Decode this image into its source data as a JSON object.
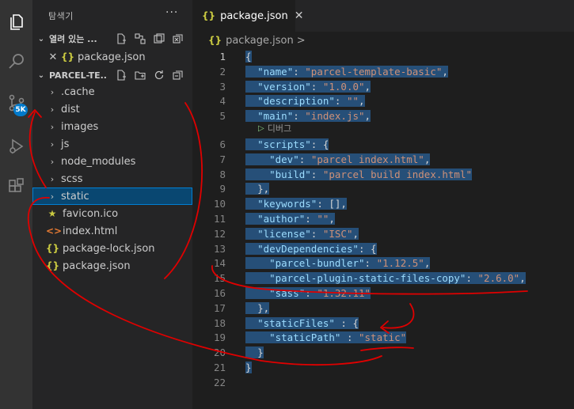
{
  "activity_bar": {
    "items": [
      {
        "icon": "files-icon"
      },
      {
        "icon": "search-icon"
      },
      {
        "icon": "source-control-icon",
        "badge": "5K"
      },
      {
        "icon": "run-debug-icon"
      },
      {
        "icon": "extensions-icon"
      }
    ],
    "accent": "#007acc"
  },
  "sidebar": {
    "title": "탐색기",
    "more": "···",
    "open_editors": {
      "label": "열려 있는 ...",
      "items": [
        {
          "name": "package.json",
          "icon": "json-icon"
        }
      ]
    },
    "project": {
      "label": "PARCEL-TE...",
      "items": [
        {
          "name": ".cache",
          "type": "folder"
        },
        {
          "name": "dist",
          "type": "folder"
        },
        {
          "name": "images",
          "type": "folder"
        },
        {
          "name": "js",
          "type": "folder"
        },
        {
          "name": "node_modules",
          "type": "folder"
        },
        {
          "name": "scss",
          "type": "folder"
        },
        {
          "name": "static",
          "type": "folder",
          "selected": true
        },
        {
          "name": "favicon.ico",
          "type": "file",
          "icon": "star-icon"
        },
        {
          "name": "index.html",
          "type": "file",
          "icon": "html-icon"
        },
        {
          "name": "package-lock.json",
          "type": "file",
          "icon": "json-icon"
        },
        {
          "name": "package.json",
          "type": "file",
          "icon": "json-icon"
        }
      ]
    }
  },
  "editor": {
    "tab_label": "package.json",
    "breadcrumb": "package.json",
    "breadcrumb_sep": ">",
    "codelens": "디버그",
    "active_line": 1,
    "lines": [
      "{",
      "  \"name\": \"parcel-template-basic\",",
      "  \"version\": \"1.0.0\",",
      "  \"description\": \"\",",
      "  \"main\": \"index.js\",",
      "  \"scripts\": {",
      "    \"dev\": \"parcel index.html\",",
      "    \"build\": \"parcel build index.html\"",
      "  },",
      "  \"keywords\": [],",
      "  \"author\": \"\",",
      "  \"license\": \"ISC\",",
      "  \"devDependencies\": {",
      "    \"parcel-bundler\": \"1.12.5\",",
      "    \"parcel-plugin-static-files-copy\": \"2.6.0\",",
      "    \"sass\": \"1.32.11\"",
      "  },",
      "  \"staticFiles\" : {",
      "    \"staticPath\" : \"static\"",
      "  }",
      "}",
      ""
    ],
    "colors": {
      "key": "#9cdcfe",
      "string": "#ce9178",
      "punct": "#d4d4d4",
      "selection": "#264f78",
      "annotation": "#e00000"
    }
  }
}
